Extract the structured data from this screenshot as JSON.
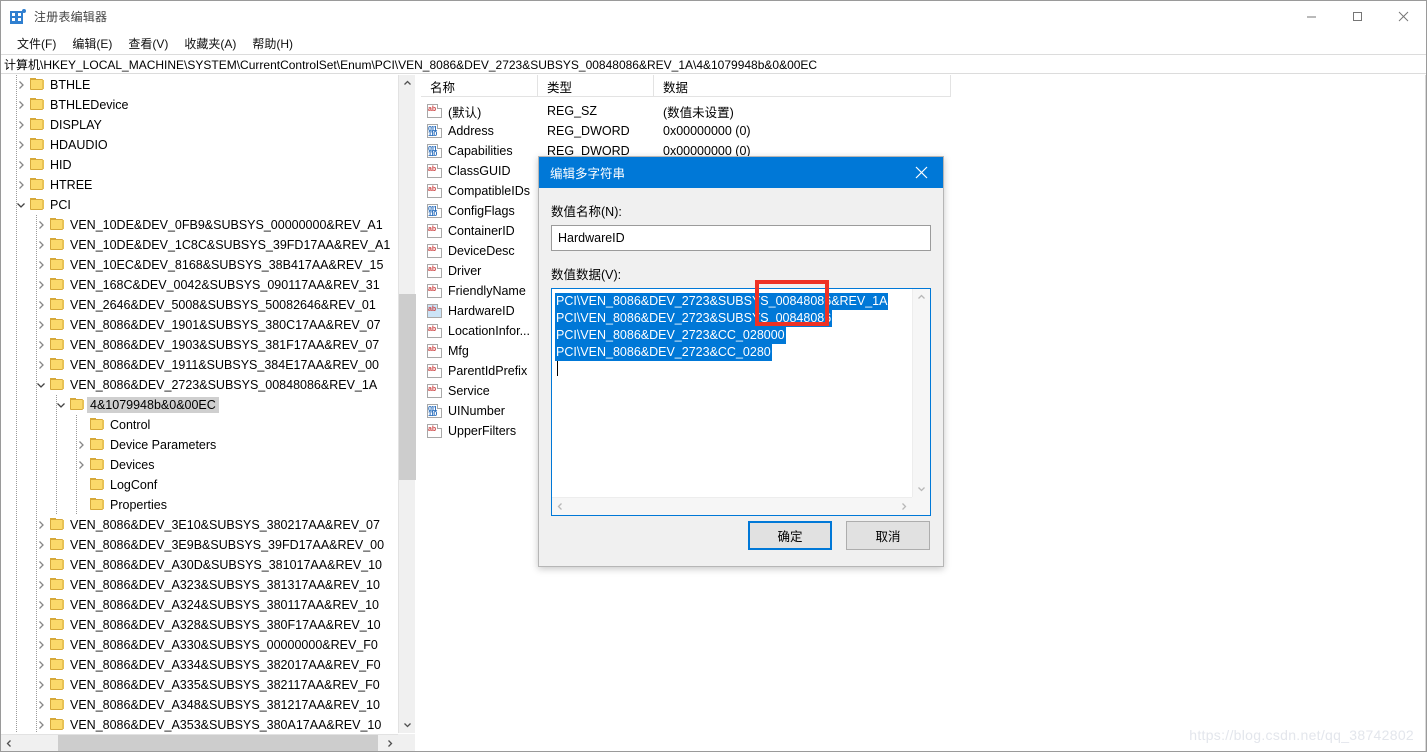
{
  "window": {
    "title": "注册表编辑器",
    "icon": "registry-icon",
    "minimize_label": "最小化",
    "maximize_label": "最大化",
    "close_label": "关闭"
  },
  "menu": {
    "items": [
      {
        "label": "文件(F)",
        "name": "menu-file"
      },
      {
        "label": "编辑(E)",
        "name": "menu-edit"
      },
      {
        "label": "查看(V)",
        "name": "menu-view"
      },
      {
        "label": "收藏夹(A)",
        "name": "menu-favorites"
      },
      {
        "label": "帮助(H)",
        "name": "menu-help"
      }
    ]
  },
  "address": {
    "path": "计算机\\HKEY_LOCAL_MACHINE\\SYSTEM\\CurrentControlSet\\Enum\\PCI\\VEN_8086&DEV_2723&SUBSYS_00848086&REV_1A\\4&1079948b&0&00EC"
  },
  "tree": {
    "nodes": [
      {
        "label": "BTHLE",
        "depth": 1,
        "state": "collapsed",
        "selected": false
      },
      {
        "label": "BTHLEDevice",
        "depth": 1,
        "state": "collapsed",
        "selected": false
      },
      {
        "label": "DISPLAY",
        "depth": 1,
        "state": "collapsed",
        "selected": false
      },
      {
        "label": "HDAUDIO",
        "depth": 1,
        "state": "collapsed",
        "selected": false
      },
      {
        "label": "HID",
        "depth": 1,
        "state": "collapsed",
        "selected": false
      },
      {
        "label": "HTREE",
        "depth": 1,
        "state": "collapsed",
        "selected": false
      },
      {
        "label": "PCI",
        "depth": 1,
        "state": "expanded",
        "selected": false
      },
      {
        "label": "VEN_10DE&DEV_0FB9&SUBSYS_00000000&REV_A1",
        "depth": 2,
        "state": "collapsed",
        "selected": false
      },
      {
        "label": "VEN_10DE&DEV_1C8C&SUBSYS_39FD17AA&REV_A1",
        "depth": 2,
        "state": "collapsed",
        "selected": false
      },
      {
        "label": "VEN_10EC&DEV_8168&SUBSYS_38B417AA&REV_15",
        "depth": 2,
        "state": "collapsed",
        "selected": false
      },
      {
        "label": "VEN_168C&DEV_0042&SUBSYS_090117AA&REV_31",
        "depth": 2,
        "state": "collapsed",
        "selected": false
      },
      {
        "label": "VEN_2646&DEV_5008&SUBSYS_50082646&REV_01",
        "depth": 2,
        "state": "collapsed",
        "selected": false
      },
      {
        "label": "VEN_8086&DEV_1901&SUBSYS_380C17AA&REV_07",
        "depth": 2,
        "state": "collapsed",
        "selected": false
      },
      {
        "label": "VEN_8086&DEV_1903&SUBSYS_381F17AA&REV_07",
        "depth": 2,
        "state": "collapsed",
        "selected": false
      },
      {
        "label": "VEN_8086&DEV_1911&SUBSYS_384E17AA&REV_00",
        "depth": 2,
        "state": "collapsed",
        "selected": false
      },
      {
        "label": "VEN_8086&DEV_2723&SUBSYS_00848086&REV_1A",
        "depth": 2,
        "state": "expanded",
        "selected": false
      },
      {
        "label": "4&1079948b&0&00EC",
        "depth": 3,
        "state": "expanded",
        "selected": true
      },
      {
        "label": "Control",
        "depth": 4,
        "state": "leaf",
        "selected": false
      },
      {
        "label": "Device Parameters",
        "depth": 4,
        "state": "collapsed",
        "selected": false
      },
      {
        "label": "Devices",
        "depth": 4,
        "state": "collapsed",
        "selected": false
      },
      {
        "label": "LogConf",
        "depth": 4,
        "state": "leaf",
        "selected": false
      },
      {
        "label": "Properties",
        "depth": 4,
        "state": "leaf",
        "selected": false
      },
      {
        "label": "VEN_8086&DEV_3E10&SUBSYS_380217AA&REV_07",
        "depth": 2,
        "state": "collapsed",
        "selected": false
      },
      {
        "label": "VEN_8086&DEV_3E9B&SUBSYS_39FD17AA&REV_00",
        "depth": 2,
        "state": "collapsed",
        "selected": false
      },
      {
        "label": "VEN_8086&DEV_A30D&SUBSYS_381017AA&REV_10",
        "depth": 2,
        "state": "collapsed",
        "selected": false
      },
      {
        "label": "VEN_8086&DEV_A323&SUBSYS_381317AA&REV_10",
        "depth": 2,
        "state": "collapsed",
        "selected": false
      },
      {
        "label": "VEN_8086&DEV_A324&SUBSYS_380117AA&REV_10",
        "depth": 2,
        "state": "collapsed",
        "selected": false
      },
      {
        "label": "VEN_8086&DEV_A328&SUBSYS_380F17AA&REV_10",
        "depth": 2,
        "state": "collapsed",
        "selected": false
      },
      {
        "label": "VEN_8086&DEV_A330&SUBSYS_00000000&REV_F0",
        "depth": 2,
        "state": "collapsed",
        "selected": false
      },
      {
        "label": "VEN_8086&DEV_A334&SUBSYS_382017AA&REV_F0",
        "depth": 2,
        "state": "collapsed",
        "selected": false
      },
      {
        "label": "VEN_8086&DEV_A335&SUBSYS_382117AA&REV_F0",
        "depth": 2,
        "state": "collapsed",
        "selected": false
      },
      {
        "label": "VEN_8086&DEV_A348&SUBSYS_381217AA&REV_10",
        "depth": 2,
        "state": "collapsed",
        "selected": false
      },
      {
        "label": "VEN_8086&DEV_A353&SUBSYS_380A17AA&REV_10",
        "depth": 2,
        "state": "collapsed",
        "selected": false
      }
    ]
  },
  "values": {
    "columns": [
      "名称",
      "类型",
      "数据"
    ],
    "rows": [
      {
        "name": "(默认)",
        "type": "REG_SZ",
        "data": "(数值未设置)",
        "icon": "string-value-icon",
        "selected": false
      },
      {
        "name": "Address",
        "type": "REG_DWORD",
        "data": "0x00000000 (0)",
        "icon": "dword-value-icon",
        "selected": false
      },
      {
        "name": "Capabilities",
        "type": "REG_DWORD",
        "data": "0x00000000 (0)",
        "icon": "dword-value-icon",
        "selected": false
      },
      {
        "name": "ClassGUID",
        "type": "",
        "data": "",
        "icon": "string-value-icon",
        "selected": false
      },
      {
        "name": "CompatibleIDs",
        "type": "",
        "data": "",
        "icon": "string-value-icon",
        "selected": false
      },
      {
        "name": "ConfigFlags",
        "type": "",
        "data": "",
        "icon": "dword-value-icon",
        "selected": false
      },
      {
        "name": "ContainerID",
        "type": "",
        "data": "",
        "icon": "string-value-icon",
        "selected": false
      },
      {
        "name": "DeviceDesc",
        "type": "",
        "data": "",
        "icon": "string-value-icon",
        "selected": false
      },
      {
        "name": "Driver",
        "type": "",
        "data": "",
        "icon": "string-value-icon",
        "selected": false
      },
      {
        "name": "FriendlyName",
        "type": "",
        "data": "",
        "icon": "string-value-icon",
        "selected": false
      },
      {
        "name": "HardwareID",
        "type": "",
        "data": "",
        "icon": "string-value-icon",
        "selected": true
      },
      {
        "name": "LocationInfor...",
        "type": "",
        "data": "",
        "icon": "string-value-icon",
        "selected": false
      },
      {
        "name": "Mfg",
        "type": "",
        "data": "",
        "icon": "string-value-icon",
        "selected": false
      },
      {
        "name": "ParentIdPrefix",
        "type": "",
        "data": "",
        "icon": "string-value-icon",
        "selected": false
      },
      {
        "name": "Service",
        "type": "",
        "data": "",
        "icon": "string-value-icon",
        "selected": false
      },
      {
        "name": "UINumber",
        "type": "",
        "data": "",
        "icon": "dword-value-icon",
        "selected": false
      },
      {
        "name": "UpperFilters",
        "type": "",
        "data": "",
        "icon": "string-value-icon",
        "selected": false
      }
    ]
  },
  "dialog": {
    "title": "编辑多字符串",
    "close_icon": "close-icon",
    "name_label": "数值名称(N):",
    "name_value": "HardwareID",
    "data_label": "数值数据(V):",
    "data_lines": [
      "PCI\\VEN_8086&DEV_2723&SUBSYS_00848086&REV_1A",
      "PCI\\VEN_8086&DEV_2723&SUBSYS_00848086",
      "PCI\\VEN_8086&DEV_2723&CC_028000",
      "PCI\\VEN_8086&DEV_2723&CC_0280"
    ],
    "ok_label": "确定",
    "cancel_label": "取消",
    "annotation": "00848086"
  },
  "watermark": {
    "text": "https://blog.csdn.net/qq_38742802"
  },
  "colors": {
    "accent": "#0078d7",
    "selection": "#0078d7",
    "annotation_red": "#ee3124",
    "folder": "#fbd96b",
    "tree_selected": "#cfcfcf"
  }
}
